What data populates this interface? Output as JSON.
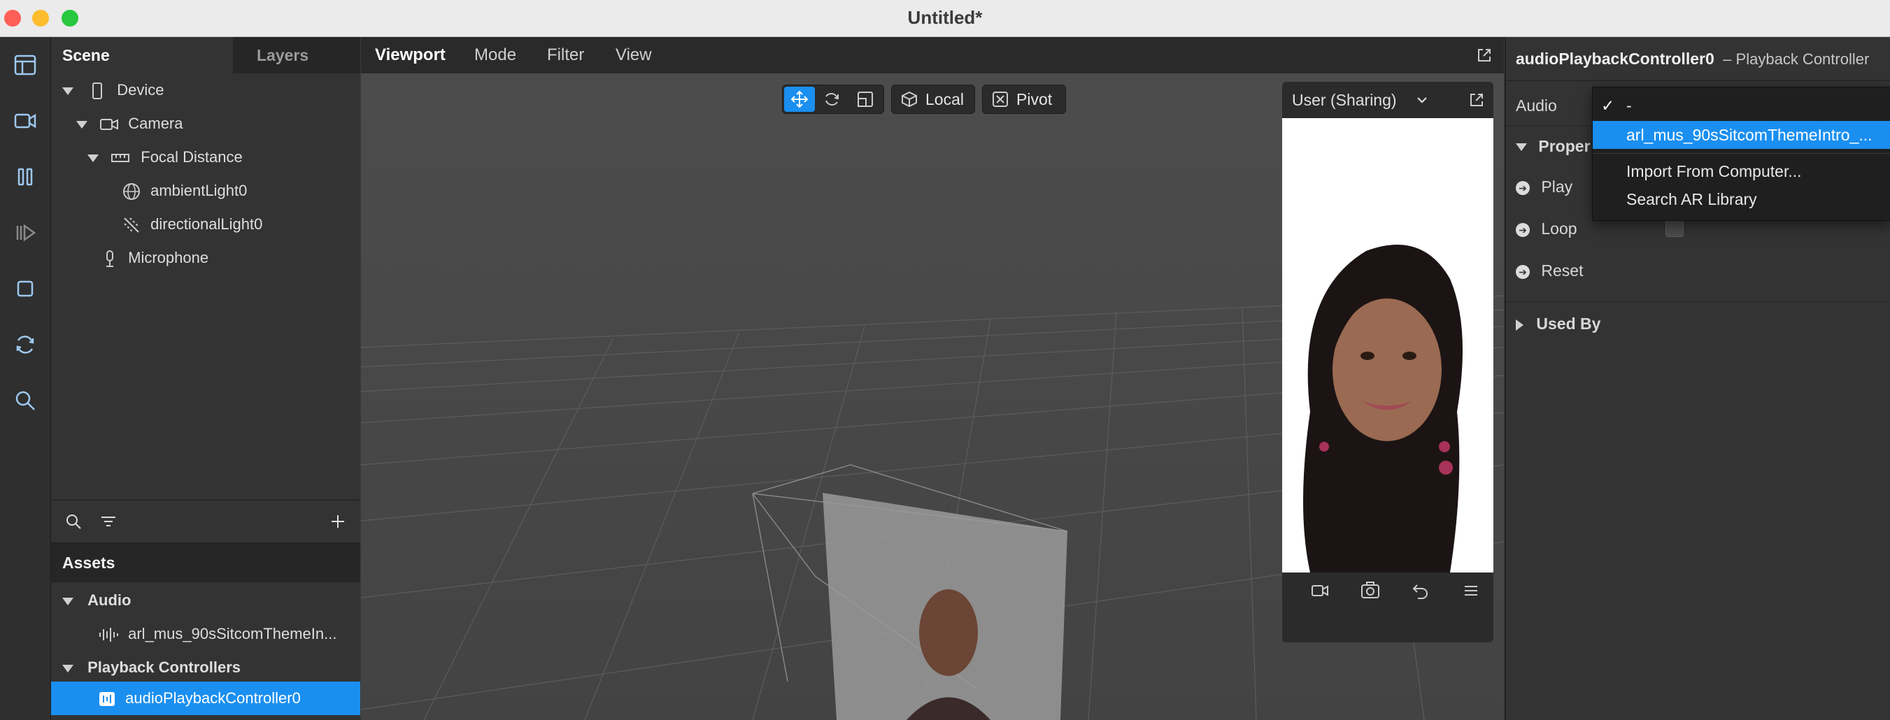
{
  "window": {
    "title": "Untitled*"
  },
  "scene_panel": {
    "tabs": [
      "Scene",
      "Layers"
    ],
    "tree": [
      {
        "label": "Device"
      },
      {
        "label": "Camera"
      },
      {
        "label": "Focal Distance"
      },
      {
        "label": "ambientLight0"
      },
      {
        "label": "directionalLight0"
      },
      {
        "label": "Microphone"
      }
    ]
  },
  "assets": {
    "title": "Assets",
    "audio_section": "Audio",
    "audio_item": "arl_mus_90sSitcomThemeIn...",
    "playback_section": "Playback Controllers",
    "playback_item": "audioPlaybackController0"
  },
  "viewport": {
    "menu": [
      "Viewport",
      "Mode",
      "Filter",
      "View"
    ],
    "local_label": "Local",
    "pivot_label": "Pivot",
    "preview_device": "User (Sharing)"
  },
  "inspector": {
    "object_name": "audioPlaybackController0",
    "object_type": "– Playback Controller",
    "audio_label": "Audio",
    "properties_label": "Proper",
    "play_label": "Play",
    "loop_label": "Loop",
    "reset_label": "Reset",
    "used_by_label": "Used By"
  },
  "dropdown": {
    "items": [
      {
        "label": "-",
        "checked": true
      },
      {
        "label": "arl_mus_90sSitcomThemeIntro_...",
        "highlighted": true
      },
      {
        "label": "Import From Computer..."
      },
      {
        "label": "Search AR Library"
      }
    ]
  },
  "colors": {
    "accent": "#1a8ff0",
    "panel": "#333333",
    "viewport": "#4a4a4a"
  }
}
